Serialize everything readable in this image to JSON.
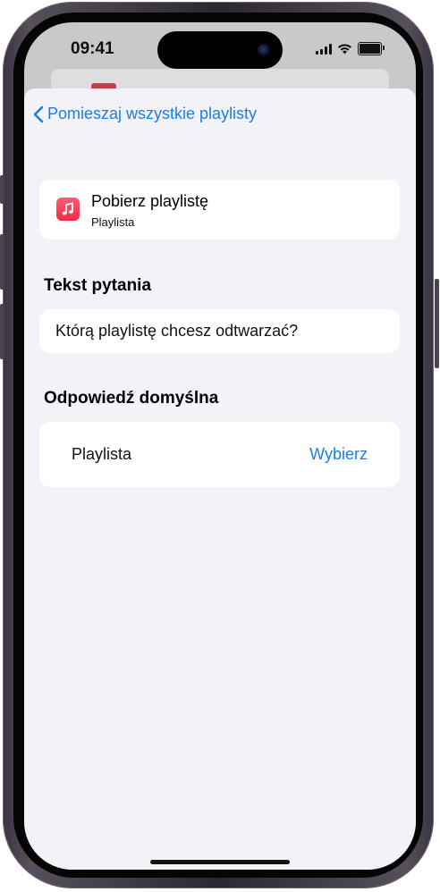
{
  "status_bar": {
    "time": "09:41",
    "icons": [
      "cellular-signal-icon",
      "wifi-icon",
      "battery-icon"
    ]
  },
  "navigation": {
    "back_label": "Pomieszaj wszystkie playlisty",
    "back_icon": "chevron-left-icon"
  },
  "action": {
    "icon": "music-note-icon",
    "icon_color": "#f73d56",
    "title": "Pobierz playlistę",
    "subtitle": "Playlista"
  },
  "prompt_section": {
    "heading": "Tekst pytania",
    "text": "Którą playlistę chcesz odtwarzać?"
  },
  "default_section": {
    "heading": "Odpowiedź domyślna",
    "label": "Playlista",
    "choose_label": "Wybierz"
  },
  "colors": {
    "accent": "#1a7cf2",
    "sheet_background": "#f2f2f7",
    "card_background": "#ffffff"
  }
}
